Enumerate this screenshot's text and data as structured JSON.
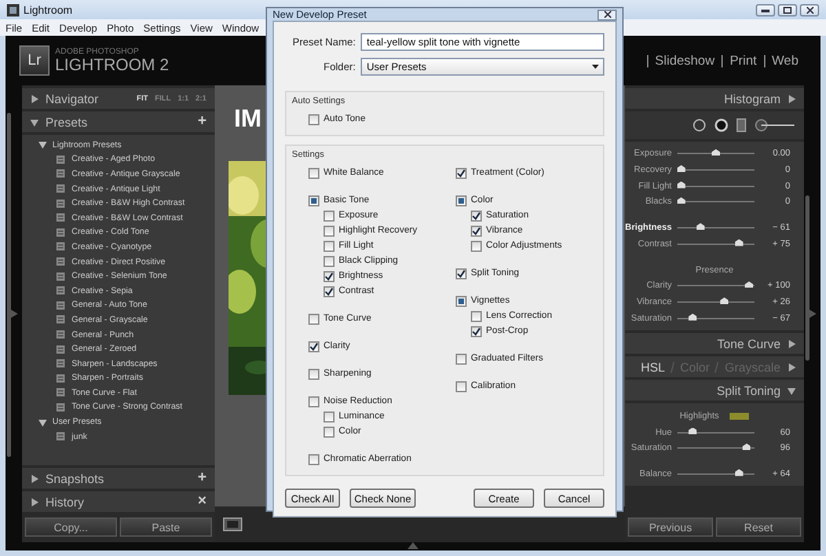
{
  "window": {
    "title": "Lightroom"
  },
  "menu": [
    "File",
    "Edit",
    "Develop",
    "Photo",
    "Settings",
    "View",
    "Window"
  ],
  "logo": {
    "badge": "Lr",
    "line_1": "ADOBE PHOTOSHOP",
    "line_2": "LIGHTROOM 2"
  },
  "modules": [
    "Slideshow",
    "Print",
    "Web"
  ],
  "left_panels": [
    {
      "title": "Navigator",
      "expanded": false,
      "zoom_options": [
        {
          "label": "FIT",
          "selected": true
        },
        {
          "label": "FILL",
          "selected": false
        },
        {
          "label": "1:1",
          "selected": false
        },
        {
          "label": "2:1",
          "selected": false
        }
      ]
    },
    {
      "title": "Presets",
      "expanded": true,
      "action": "+",
      "folders": [
        {
          "label": "Lightroom Presets",
          "expanded": true,
          "children": [
            {
              "label": "Creative - Aged Photo"
            },
            {
              "label": "Creative - Antique Grayscale"
            },
            {
              "label": "Creative - Antique Light"
            },
            {
              "label": "Creative - B&W High Contrast"
            },
            {
              "label": "Creative - B&W Low Contrast"
            },
            {
              "label": "Creative - Cold Tone"
            },
            {
              "label": "Creative - Cyanotype"
            },
            {
              "label": "Creative - Direct Positive"
            },
            {
              "label": "Creative - Selenium Tone"
            },
            {
              "label": "Creative - Sepia"
            },
            {
              "label": "General - Auto Tone"
            },
            {
              "label": "General - Grayscale"
            },
            {
              "label": "General - Punch"
            },
            {
              "label": "General - Zeroed"
            },
            {
              "label": "Sharpen - Landscapes"
            },
            {
              "label": "Sharpen - Portraits"
            },
            {
              "label": "Tone Curve - Flat"
            },
            {
              "label": "Tone Curve - Strong Contrast"
            }
          ]
        },
        {
          "label": "User Presets",
          "expanded": true,
          "children": [
            {
              "label": "junk"
            }
          ]
        }
      ]
    },
    {
      "title": "Snapshots",
      "expanded": false,
      "action": "+"
    },
    {
      "title": "History",
      "expanded": false,
      "action": "×"
    }
  ],
  "left_buttons": [
    "Copy...",
    "Paste"
  ],
  "center": {
    "heading": "IM"
  },
  "dialog": {
    "title": "New Develop Preset",
    "preset_name": {
      "label": "Preset Name:",
      "value": "teal-yellow split tone with vignette"
    },
    "folder": {
      "label": "Folder:",
      "value": "User Presets"
    },
    "auto_settings": {
      "title": "Auto Settings",
      "items": [
        {
          "label": "Auto Tone",
          "checked": false
        }
      ]
    },
    "settings": {
      "title": "Settings",
      "columns": [
        [
          {
            "label": "White Balance",
            "checked": false
          },
          {
            "label": "Basic Tone",
            "checked": true,
            "partial": true,
            "children": [
              {
                "label": "Exposure",
                "checked": false
              },
              {
                "label": "Highlight Recovery",
                "checked": false
              },
              {
                "label": "Fill Light",
                "checked": false
              },
              {
                "label": "Black Clipping",
                "checked": false
              },
              {
                "label": "Brightness",
                "checked": true
              },
              {
                "label": "Contrast",
                "checked": true
              }
            ]
          },
          {
            "label": "Tone Curve",
            "checked": false
          },
          {
            "label": "Clarity",
            "checked": true
          },
          {
            "label": "Sharpening",
            "checked": false
          },
          {
            "label": "Noise Reduction",
            "checked": false,
            "children": [
              {
                "label": "Luminance",
                "checked": false
              },
              {
                "label": "Color",
                "checked": false
              }
            ]
          },
          {
            "label": "Chromatic Aberration",
            "checked": false
          }
        ],
        [
          {
            "label": "Treatment (Color)",
            "checked": true
          },
          {
            "label": "Color",
            "checked": true,
            "partial": true,
            "children": [
              {
                "label": "Saturation",
                "checked": true
              },
              {
                "label": "Vibrance",
                "checked": true
              },
              {
                "label": "Color Adjustments",
                "checked": false
              }
            ]
          },
          {
            "label": "Split Toning",
            "checked": true
          },
          {
            "label": "Vignettes",
            "checked": true,
            "partial": true,
            "children": [
              {
                "label": "Lens Correction",
                "checked": false
              },
              {
                "label": "Post-Crop",
                "checked": true
              }
            ]
          },
          {
            "label": "Graduated Filters",
            "checked": false
          },
          {
            "label": "Calibration",
            "checked": false
          }
        ]
      ]
    },
    "buttons_left": [
      "Check All",
      "Check None"
    ],
    "buttons_right": [
      "Create",
      "Cancel"
    ]
  },
  "right_panel": {
    "histogram": {
      "title": "Histogram"
    },
    "basic_groups": [
      {
        "sliders": [
          {
            "label": "Exposure",
            "reading": "0.00",
            "level": 0.5,
            "bold": false
          },
          {
            "label": "Recovery",
            "reading": "0",
            "level": 0.05,
            "bold": false
          },
          {
            "label": "Fill Light",
            "reading": "0",
            "level": 0.05,
            "bold": false
          },
          {
            "label": "Blacks",
            "reading": "0",
            "level": 0.05,
            "bold": false
          }
        ]
      },
      {
        "sliders": [
          {
            "label": "Brightness",
            "reading": "− 61",
            "level": 0.3,
            "bold": true
          },
          {
            "label": "Contrast",
            "reading": "+ 75",
            "level": 0.8,
            "bold": false
          }
        ]
      },
      {
        "heading": "Presence",
        "sliders": [
          {
            "label": "Clarity",
            "reading": "+ 100",
            "level": 0.93,
            "bold": false
          },
          {
            "label": "Vibrance",
            "reading": "+ 26",
            "level": 0.61,
            "bold": false
          },
          {
            "label": "Saturation",
            "reading": "− 67",
            "level": 0.2,
            "bold": false
          }
        ]
      }
    ],
    "tone_curve": {
      "title": "Tone Curve"
    },
    "hsl_tabs": [
      {
        "label": "HSL",
        "selected": true
      },
      {
        "label": "Color",
        "selected": false
      },
      {
        "label": "Grayscale",
        "selected": false
      }
    ],
    "split_toning": {
      "title": "Split Toning",
      "subheading": "Highlights",
      "sliders": [
        {
          "label": "Hue",
          "reading": "60",
          "level": 0.2,
          "bold": false
        },
        {
          "label": "Saturation",
          "reading": "96",
          "level": 0.9,
          "bold": false
        },
        {
          "label": "Balance",
          "reading": "+ 64",
          "level": 0.8,
          "bold": false
        }
      ]
    },
    "buttons": [
      "Previous",
      "Reset"
    ]
  }
}
